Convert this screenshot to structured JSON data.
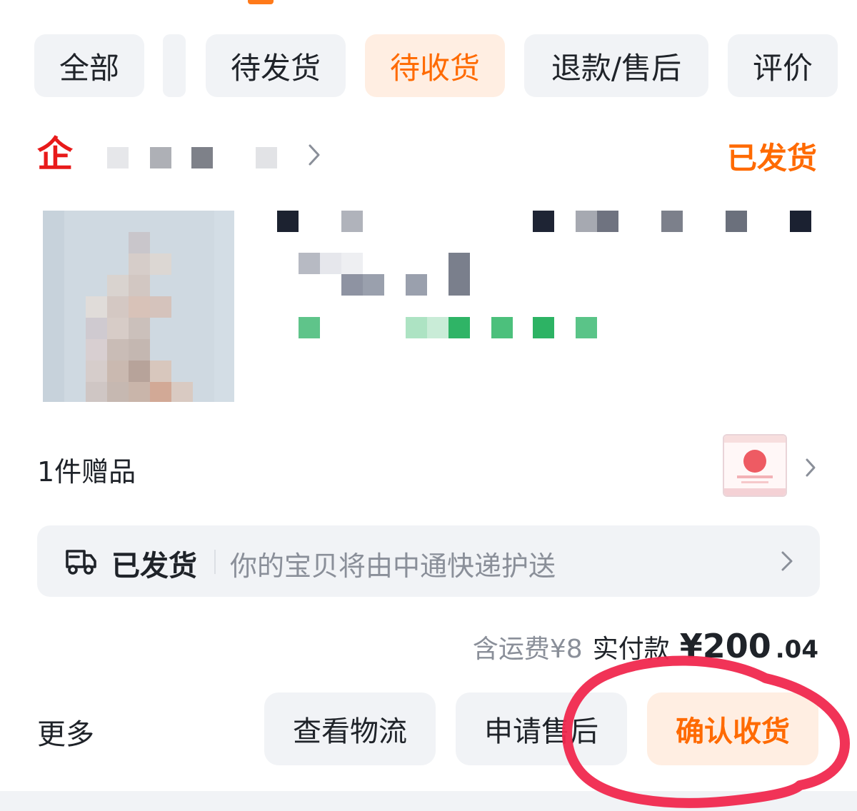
{
  "tabs": [
    {
      "label": "全部",
      "active": false
    },
    {
      "label": "待发货",
      "active": false
    },
    {
      "label": "待收货",
      "active": true
    },
    {
      "label": "退款/售后",
      "active": false
    },
    {
      "label": "评价",
      "active": false
    }
  ],
  "order": {
    "shop_badge": "企",
    "status": "已发货",
    "gift": {
      "label": "1件赠品"
    },
    "shipping": {
      "status": "已发货",
      "description": "你的宝贝将由中通快递护送"
    },
    "price": {
      "shipping_fee": "含运费¥8",
      "paid_label": "实付款",
      "paid_amount": "¥200",
      "paid_cents": ".04"
    }
  },
  "actions": {
    "more": "更多",
    "view_logistics": "查看物流",
    "after_sale": "申请售后",
    "confirm_receipt": "确认收货"
  },
  "colors": {
    "accent": "#ff6a00",
    "accent_bg": "#ffeee2",
    "chip_bg": "#f1f3f6",
    "shop_logo": "#e81a1a",
    "annotation": "#f0284e"
  },
  "icons": {
    "shop_link": "chevron-right-icon",
    "gift_link": "chevron-right-icon",
    "shipping": "truck-icon",
    "shipping_link": "chevron-right-icon"
  }
}
